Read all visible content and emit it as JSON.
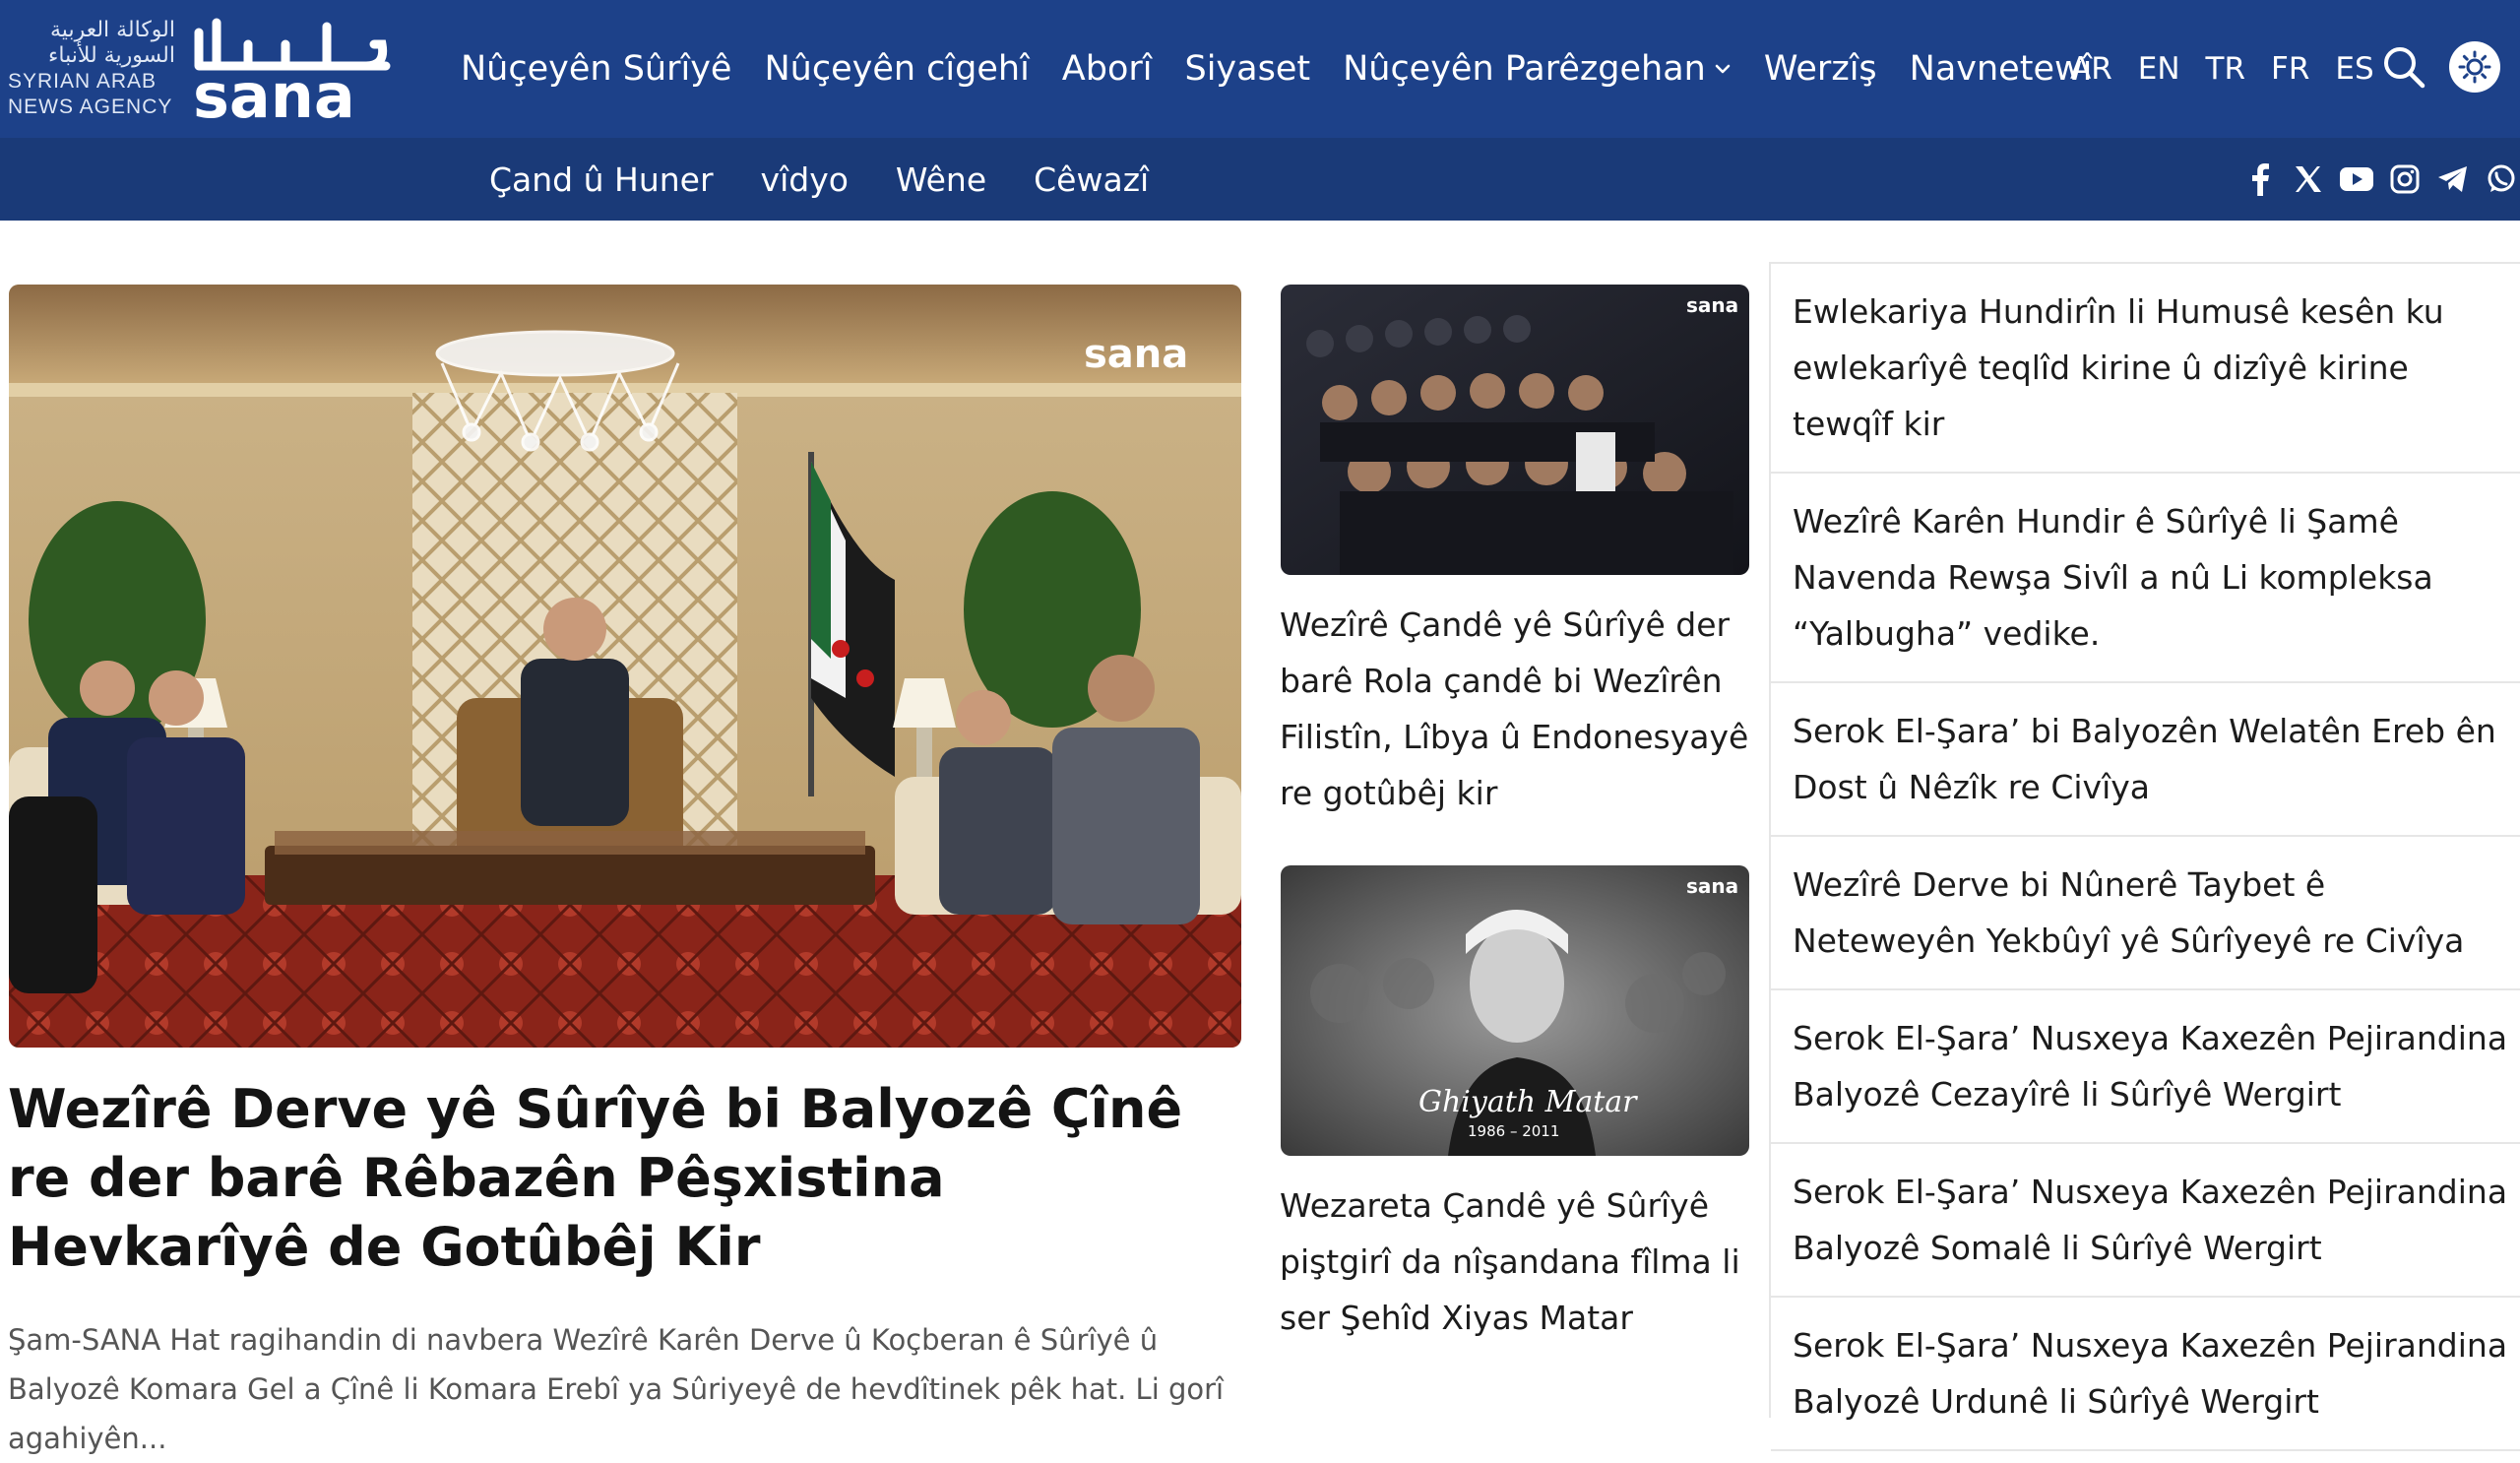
{
  "header": {
    "logo": {
      "arabic_lines": [
        "الوكالة العربية",
        "السورية للأنباء"
      ],
      "english_lines": [
        "SYRIAN ARAB",
        "NEWS AGENCY"
      ],
      "wordmark": "sana",
      "wordmark_arabic": "سانا"
    },
    "nav": [
      {
        "label": "Nûçeyên Sûrîyê"
      },
      {
        "label": "Nûçeyên cîgehî"
      },
      {
        "label": "Aborî"
      },
      {
        "label": "Siyaset"
      },
      {
        "label": "Nûçeyên Parêzgehan",
        "has_dropdown": true,
        "icon": "chevron-down-icon"
      },
      {
        "label": "Werzîş"
      },
      {
        "label": "Navnetewî"
      }
    ],
    "languages": [
      "AR",
      "EN",
      "TR",
      "FR",
      "ES"
    ],
    "icons": {
      "search": "search-icon",
      "theme": "sun-icon"
    }
  },
  "subnav": {
    "items": [
      {
        "label": "Çand û Huner"
      },
      {
        "label": "vîdyo"
      },
      {
        "label": "Wêne"
      },
      {
        "label": "Cêwazî"
      }
    ],
    "socials": [
      "facebook-icon",
      "x-icon",
      "youtube-icon",
      "instagram-icon",
      "telegram-icon",
      "whatsapp-icon"
    ]
  },
  "lead": {
    "image_alt": "Meeting room with officials and Syrian flag",
    "watermark": "sana",
    "title": "Wezîrê Derve yê Sûrîyê bi Balyozê Çînê re der barê Rêbazên Pêşxistina Hevkarîyê de Gotûbêj Kir",
    "excerpt": "Şam-SANA Hat ragihandin di navbera Wezîrê Karên Derve û Koçberan ê Sûrîyê û Balyozê Komara Gel a Çînê li Komara Erebî ya Sûriyeyê de hevdîtinek pêk hat. Li gorî agahiyên..."
  },
  "middle": [
    {
      "image_alt": "Conference audience",
      "watermark": "sana",
      "title": "Wezîrê Çandê yê Sûrîyê der barê Rola çandê bi Wezîrên Filistîn, Lîbya û Endonesyayê re gotûbêj kir"
    },
    {
      "image_alt": "Portrait of Ghiyath Matar",
      "watermark": "sana",
      "caption_name": "Ghiyath Matar",
      "caption_years": "1986 – 2011",
      "title": "Wezareta Çandê yê Sûrîyê piştgirî da nîşandana fîlma li ser Şehîd Xiyas Matar"
    }
  ],
  "sidebar": {
    "items": [
      {
        "title": "Ewlekariya Hundirîn li Humusê kesên ku ewlekarîyê teqlîd kirine û dizîyê kirine tewqîf kir"
      },
      {
        "title": "Wezîrê Karên Hundir ê Sûrîyê li Şamê Navenda Rewşa Sivîl a nû Li kompleksa “Yalbugha” vedike."
      },
      {
        "title": "Serok El-Şara’ bi Balyozên Welatên Ereb ên Dost û Nêzîk re Civîya"
      },
      {
        "title": "Wezîrê Derve bi Nûnerê Taybet ê Neteweyên Yekbûyî yê Sûrîyeyê re Civîya"
      },
      {
        "title": "Serok El-Şara’ Nusxeya Kaxezên Pejirandina Balyozê Cezayîrê li Sûrîyê Wergirt"
      },
      {
        "title": "Serok El-Şara’ Nusxeya Kaxezên Pejirandina Balyozê Somalê li Sûrîyê Wergirt"
      },
      {
        "title": "Serok El-Şara’ Nusxeya Kaxezên Pejirandina Balyozê Urdunê li Sûrîyê Wergirt"
      }
    ]
  },
  "colors": {
    "header_bg": "#1d4189",
    "subnav_bg": "#1a3a78",
    "text_dark": "#141414",
    "text_muted": "#555555",
    "divider": "#e6e6e6"
  }
}
